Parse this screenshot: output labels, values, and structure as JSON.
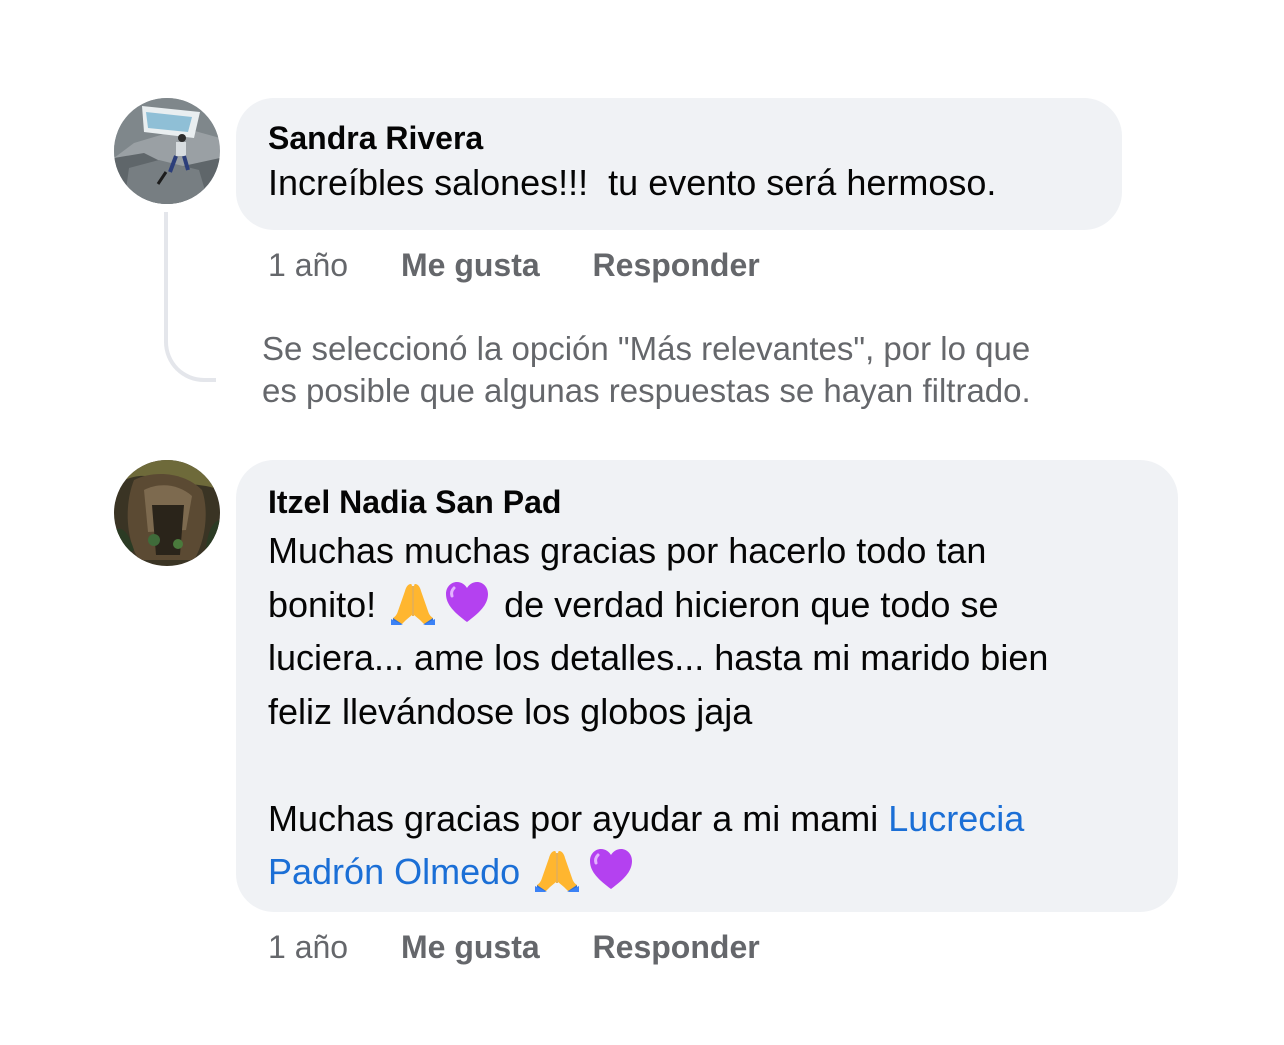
{
  "comments": [
    {
      "author": "Sandra Rivera",
      "text": "Increíbles salones!!!  tu evento será hermoso.",
      "time": "1 año",
      "like_label": "Me gusta",
      "reply_label": "Responder"
    },
    {
      "author": "Itzel Nadia San Pad",
      "text_line1": "Muchas muchas gracias por hacerlo todo tan",
      "text_line2_a": "bonito!",
      "text_line2_b": "de verdad hicieron que todo se",
      "text_line3": "luciera... ame los detalles... hasta mi marido bien",
      "text_line4": "feliz llevándose los globos jaja",
      "text_line5": "Muchas gracias por ayudar a mi mami",
      "mention_a": "Lucrecia",
      "mention_b": "Padrón Olmedo",
      "time": "1 año",
      "like_label": "Me gusta",
      "reply_label": "Responder"
    }
  ],
  "filter_notice": {
    "line1": "Se seleccionó la opción \"Más relevantes\", por lo que",
    "line2": "es posible que algunas respuestas se hayan filtrado."
  },
  "emojis": [
    "folded-hands",
    "purple-heart"
  ],
  "colors": {
    "bubble": "#f0f2f5",
    "secondary_text": "#65676b",
    "mention": "#1b6fd6",
    "thread_line": "#e4e6eb"
  }
}
